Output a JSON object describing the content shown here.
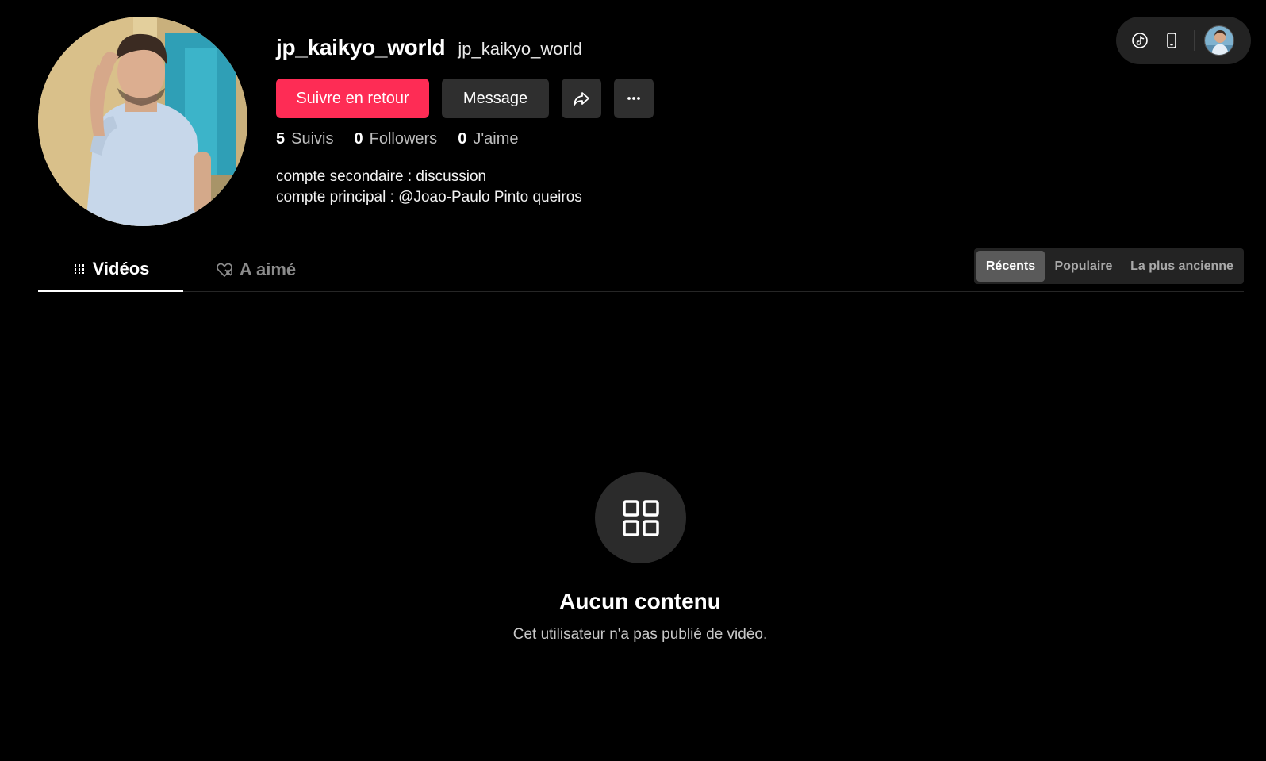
{
  "profile": {
    "unique_id": "jp_kaikyo_world",
    "nickname": "jp_kaikyo_world",
    "bio_line1": "compte secondaire : discussion",
    "bio_line2": "compte principal : @Joao-Paulo Pinto queiros"
  },
  "actions": {
    "follow_back": "Suivre en retour",
    "message": "Message",
    "share_icon": "share-arrow-icon",
    "more_icon": "more-dots-icon"
  },
  "stats": {
    "following_count": "5",
    "following_label": "Suivis",
    "followers_count": "0",
    "followers_label": "Followers",
    "likes_count": "0",
    "likes_label": "J'aime"
  },
  "top_pill": {
    "icons": [
      "tiktok-logo-icon",
      "phone-icon",
      "user-avatar"
    ]
  },
  "tabs": {
    "videos": "Vidéos",
    "liked": "A aimé"
  },
  "sort": {
    "recent": "Récents",
    "popular": "Populaire",
    "oldest": "La plus ancienne"
  },
  "empty_state": {
    "icon": "grid-icon",
    "title": "Aucun contenu",
    "description": "Cet utilisateur n'a pas publié de vidéo."
  },
  "colors": {
    "background": "#000000",
    "accent": "#fe2c55",
    "button_secondary": "#2f2f2f",
    "muted_text": "#8a8a8a"
  }
}
